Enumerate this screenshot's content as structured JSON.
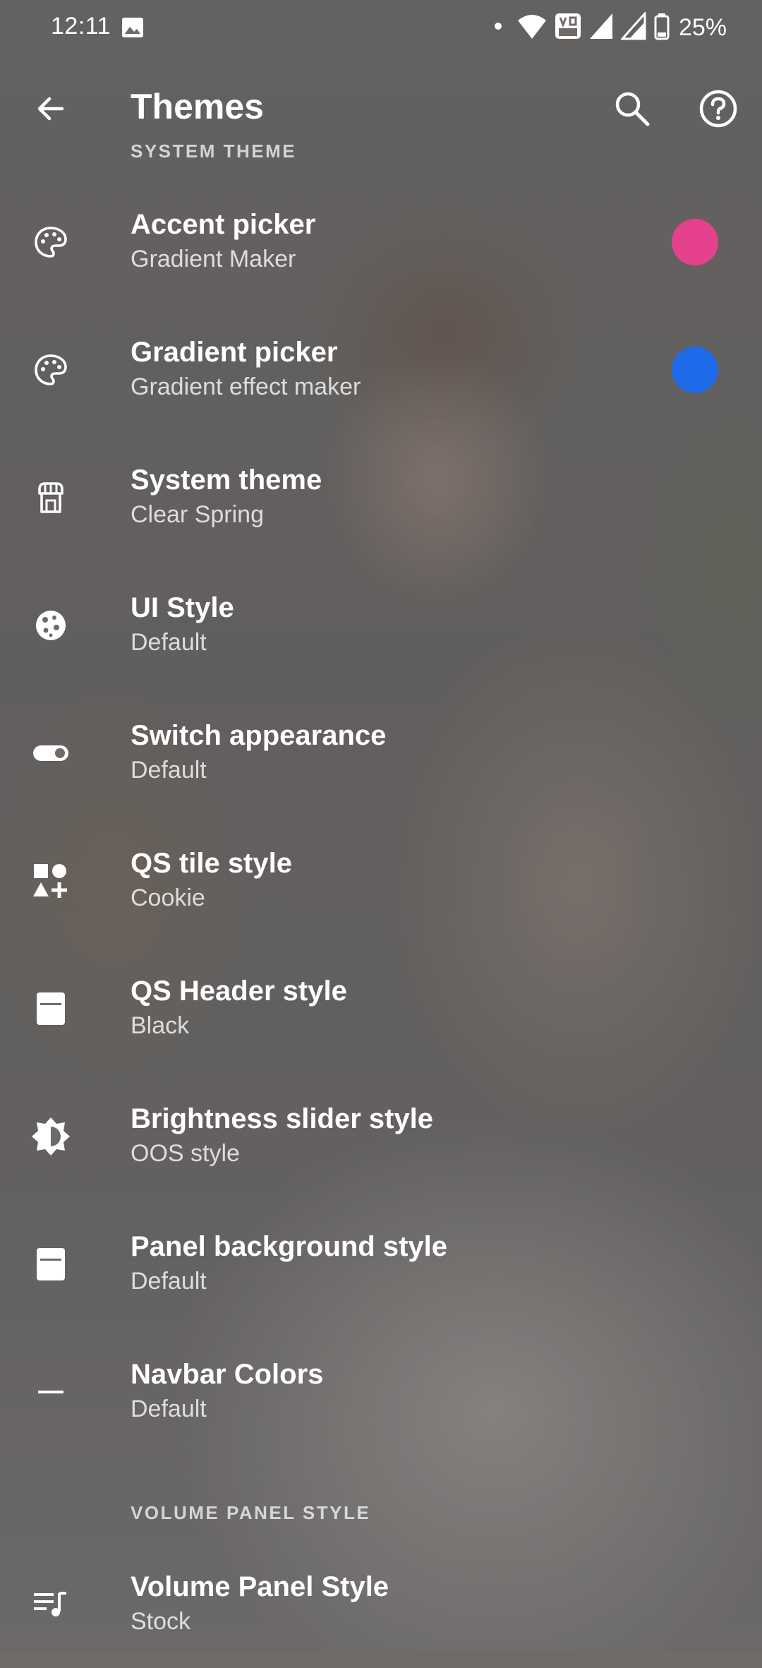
{
  "status_bar": {
    "time": "12:11",
    "battery": "25%",
    "icons": [
      "gallery-icon",
      "dot-icon",
      "wifi-icon",
      "volte-icon",
      "signal-icon",
      "signal-icon",
      "battery-icon"
    ]
  },
  "app_bar": {
    "title": "Themes",
    "back_icon": "arrow-back-icon",
    "search_icon": "search-icon",
    "help_icon": "help-icon"
  },
  "sections": {
    "system_theme": "SYSTEM THEME",
    "volume_panel": "VOLUME PANEL STYLE"
  },
  "items": [
    {
      "title": "Accent picker",
      "summary": "Gradient Maker",
      "icon": "palette-icon",
      "swatch": "#e6418c"
    },
    {
      "title": "Gradient picker",
      "summary": "Gradient effect maker",
      "icon": "palette-icon",
      "swatch": "#1e6bea"
    },
    {
      "title": "System theme",
      "summary": "Clear Spring",
      "icon": "store-icon"
    },
    {
      "title": "UI Style",
      "summary": "Default",
      "icon": "cookie-icon"
    },
    {
      "title": "Switch appearance",
      "summary": "Default",
      "icon": "toggle-icon"
    },
    {
      "title": "QS tile style",
      "summary": "Cookie",
      "icon": "shapes-icon"
    },
    {
      "title": "QS Header style",
      "summary": "Black",
      "icon": "header-panel-icon"
    },
    {
      "title": "Brightness slider style",
      "summary": "OOS style",
      "icon": "brightness-icon"
    },
    {
      "title": "Panel background style",
      "summary": "Default",
      "icon": "panel-icon"
    },
    {
      "title": "Navbar Colors",
      "summary": "Default",
      "icon": "navbar-icon"
    },
    {
      "title": "Volume Panel Style",
      "summary": "Stock",
      "icon": "queue-music-icon"
    }
  ],
  "colors": {
    "accent_swatch": "#e6418c",
    "gradient_swatch": "#1e6bea",
    "text": "#ffffff"
  }
}
